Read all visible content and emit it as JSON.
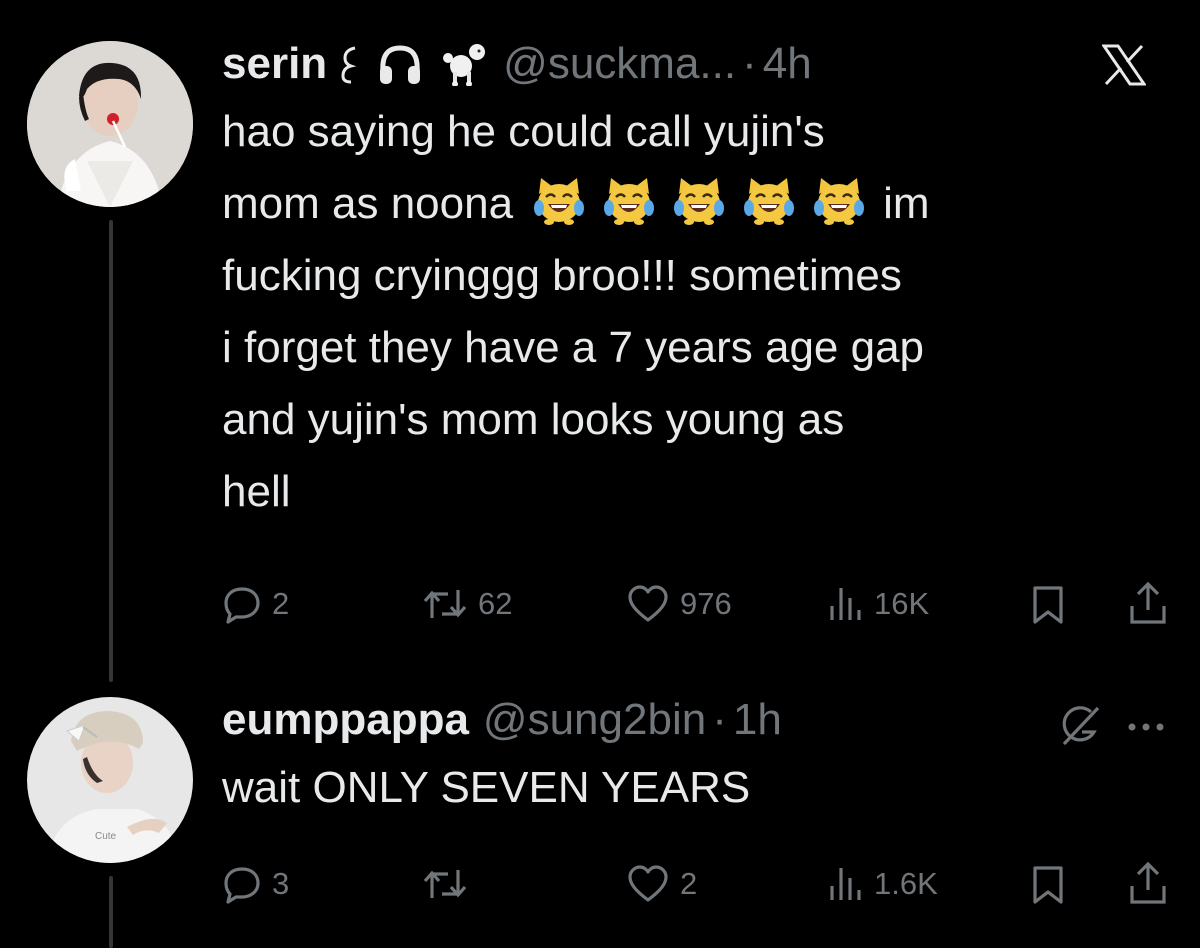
{
  "tweets": [
    {
      "display_name": "serin",
      "name_emojis": "ೃ 🎧 🐩",
      "handle": "@suckma...",
      "separator": "·",
      "time": "4h",
      "text_lines": [
        "hao saying he could call yujin's",
        "mom as noona",
        "fucking cryinggg broo!!! sometimes",
        "i forget they have a 7 years age gap",
        "and yujin's mom looks young as",
        "hell"
      ],
      "text_line2_suffix": "im",
      "emoji_count_label": "crying-laughing-cat-emoji",
      "replies": "2",
      "retweets": "62",
      "likes": "976",
      "views": "16K"
    },
    {
      "display_name": "eumppappa",
      "handle": "@sung2bin",
      "separator": "·",
      "time": "1h",
      "text_lines": [
        "wait ONLY SEVEN YEARS"
      ],
      "replies": "3",
      "retweets": "",
      "likes": "2",
      "views": "1.6K"
    }
  ],
  "icons": {
    "reply": "reply-icon",
    "retweet": "retweet-icon",
    "like": "heart-icon",
    "views": "views-icon",
    "bookmark": "bookmark-icon",
    "share": "share-icon",
    "x_logo": "x-logo-icon",
    "grok": "grok-icon",
    "more": "more-icon"
  },
  "colors": {
    "background": "#000000",
    "primary_text": "#e7e9ea",
    "secondary_text": "#71767b",
    "thread_line": "#333639"
  }
}
